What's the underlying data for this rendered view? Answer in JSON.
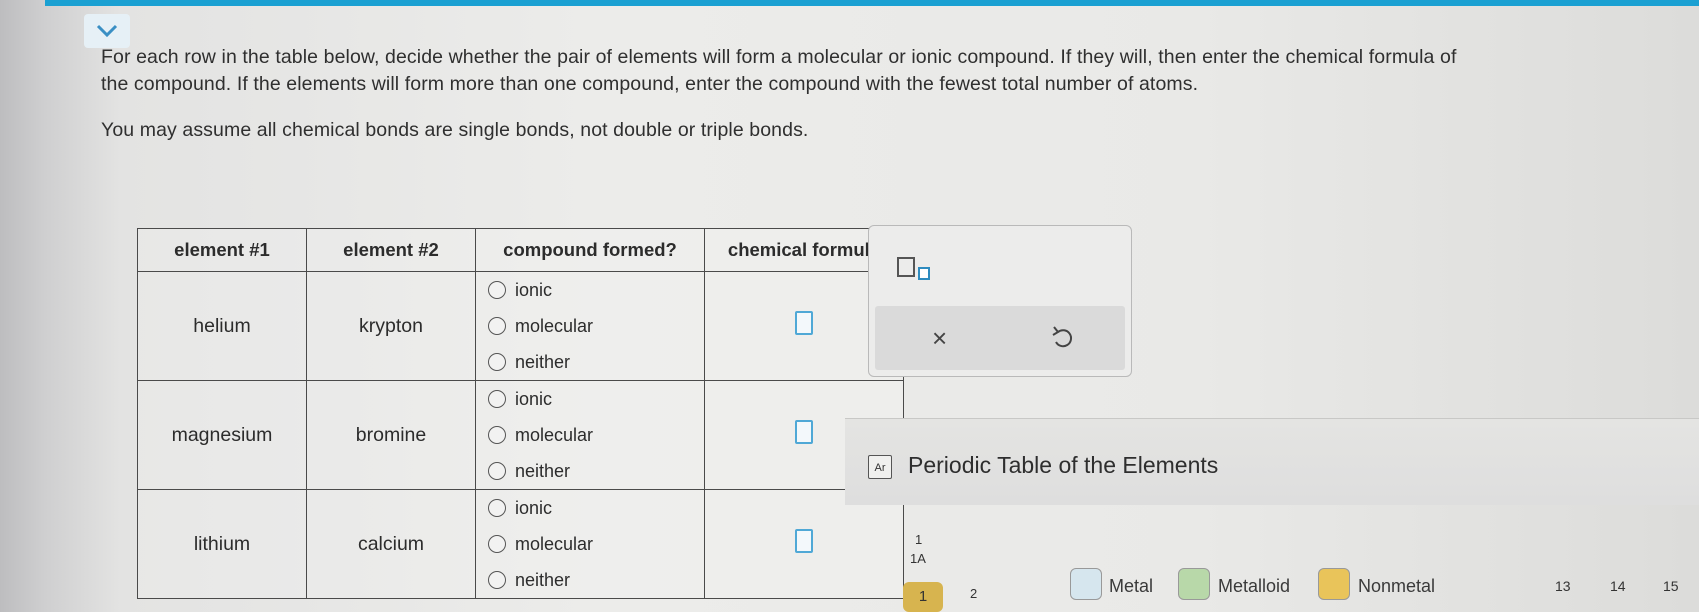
{
  "instructions": {
    "line1": "For each row in the table below, decide whether the pair of elements will form a molecular or ionic compound. If they will, then enter the chemical formula of",
    "line2": "the compound. If the elements will form more than one compound, enter the compound with the fewest total number of atoms.",
    "line3": "You may assume all chemical bonds are single bonds, not double or triple bonds."
  },
  "table": {
    "headers": [
      "element #1",
      "element #2",
      "compound formed?",
      "chemical formula"
    ],
    "rows": [
      {
        "element1": "helium",
        "element2": "krypton",
        "options": [
          "ionic",
          "molecular",
          "neither"
        ]
      },
      {
        "element1": "magnesium",
        "element2": "bromine",
        "options": [
          "ionic",
          "molecular",
          "neither"
        ]
      },
      {
        "element1": "lithium",
        "element2": "calcium",
        "options": [
          "ionic",
          "molecular",
          "neither"
        ]
      }
    ]
  },
  "tools": {
    "subscript_icon": "subscript-icon",
    "clear_label": "×",
    "undo_icon": "undo-icon"
  },
  "periodic_table": {
    "icon_label": "Ar",
    "title": "Periodic Table of the Elements",
    "group1_num": "1",
    "group1_label": "1A",
    "group2_num": "2",
    "first_cell": "1",
    "legend": [
      {
        "label": "Metal",
        "color": "#d6e6ee"
      },
      {
        "label": "Metalloid",
        "color": "#b8d8a9"
      },
      {
        "label": "Nonmetal",
        "color": "#e9c45a"
      }
    ],
    "group_numbers": [
      "13",
      "14",
      "15"
    ]
  },
  "colors": {
    "accent": "#1aa0d2",
    "answer_box": "#4fa8d6"
  }
}
